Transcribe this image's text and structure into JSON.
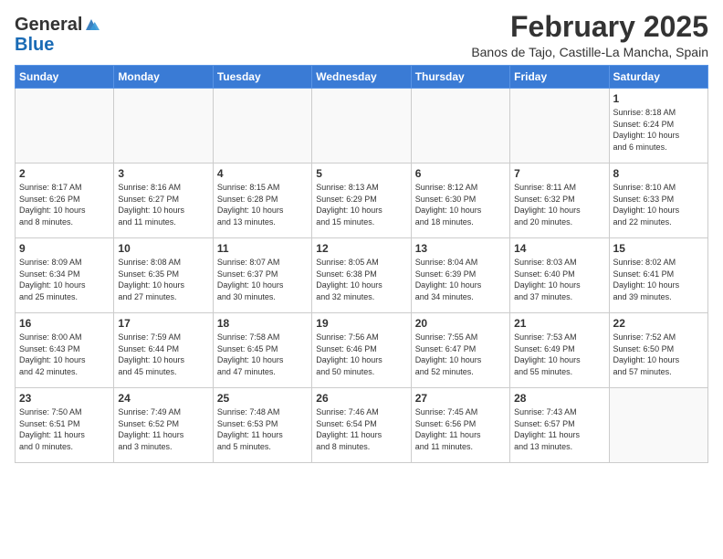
{
  "logo": {
    "general": "General",
    "blue": "Blue"
  },
  "title": {
    "month": "February 2025",
    "location": "Banos de Tajo, Castille-La Mancha, Spain"
  },
  "weekdays": [
    "Sunday",
    "Monday",
    "Tuesday",
    "Wednesday",
    "Thursday",
    "Friday",
    "Saturday"
  ],
  "weeks": [
    [
      {
        "day": "",
        "info": ""
      },
      {
        "day": "",
        "info": ""
      },
      {
        "day": "",
        "info": ""
      },
      {
        "day": "",
        "info": ""
      },
      {
        "day": "",
        "info": ""
      },
      {
        "day": "",
        "info": ""
      },
      {
        "day": "1",
        "info": "Sunrise: 8:18 AM\nSunset: 6:24 PM\nDaylight: 10 hours\nand 6 minutes."
      }
    ],
    [
      {
        "day": "2",
        "info": "Sunrise: 8:17 AM\nSunset: 6:26 PM\nDaylight: 10 hours\nand 8 minutes."
      },
      {
        "day": "3",
        "info": "Sunrise: 8:16 AM\nSunset: 6:27 PM\nDaylight: 10 hours\nand 11 minutes."
      },
      {
        "day": "4",
        "info": "Sunrise: 8:15 AM\nSunset: 6:28 PM\nDaylight: 10 hours\nand 13 minutes."
      },
      {
        "day": "5",
        "info": "Sunrise: 8:13 AM\nSunset: 6:29 PM\nDaylight: 10 hours\nand 15 minutes."
      },
      {
        "day": "6",
        "info": "Sunrise: 8:12 AM\nSunset: 6:30 PM\nDaylight: 10 hours\nand 18 minutes."
      },
      {
        "day": "7",
        "info": "Sunrise: 8:11 AM\nSunset: 6:32 PM\nDaylight: 10 hours\nand 20 minutes."
      },
      {
        "day": "8",
        "info": "Sunrise: 8:10 AM\nSunset: 6:33 PM\nDaylight: 10 hours\nand 22 minutes."
      }
    ],
    [
      {
        "day": "9",
        "info": "Sunrise: 8:09 AM\nSunset: 6:34 PM\nDaylight: 10 hours\nand 25 minutes."
      },
      {
        "day": "10",
        "info": "Sunrise: 8:08 AM\nSunset: 6:35 PM\nDaylight: 10 hours\nand 27 minutes."
      },
      {
        "day": "11",
        "info": "Sunrise: 8:07 AM\nSunset: 6:37 PM\nDaylight: 10 hours\nand 30 minutes."
      },
      {
        "day": "12",
        "info": "Sunrise: 8:05 AM\nSunset: 6:38 PM\nDaylight: 10 hours\nand 32 minutes."
      },
      {
        "day": "13",
        "info": "Sunrise: 8:04 AM\nSunset: 6:39 PM\nDaylight: 10 hours\nand 34 minutes."
      },
      {
        "day": "14",
        "info": "Sunrise: 8:03 AM\nSunset: 6:40 PM\nDaylight: 10 hours\nand 37 minutes."
      },
      {
        "day": "15",
        "info": "Sunrise: 8:02 AM\nSunset: 6:41 PM\nDaylight: 10 hours\nand 39 minutes."
      }
    ],
    [
      {
        "day": "16",
        "info": "Sunrise: 8:00 AM\nSunset: 6:43 PM\nDaylight: 10 hours\nand 42 minutes."
      },
      {
        "day": "17",
        "info": "Sunrise: 7:59 AM\nSunset: 6:44 PM\nDaylight: 10 hours\nand 45 minutes."
      },
      {
        "day": "18",
        "info": "Sunrise: 7:58 AM\nSunset: 6:45 PM\nDaylight: 10 hours\nand 47 minutes."
      },
      {
        "day": "19",
        "info": "Sunrise: 7:56 AM\nSunset: 6:46 PM\nDaylight: 10 hours\nand 50 minutes."
      },
      {
        "day": "20",
        "info": "Sunrise: 7:55 AM\nSunset: 6:47 PM\nDaylight: 10 hours\nand 52 minutes."
      },
      {
        "day": "21",
        "info": "Sunrise: 7:53 AM\nSunset: 6:49 PM\nDaylight: 10 hours\nand 55 minutes."
      },
      {
        "day": "22",
        "info": "Sunrise: 7:52 AM\nSunset: 6:50 PM\nDaylight: 10 hours\nand 57 minutes."
      }
    ],
    [
      {
        "day": "23",
        "info": "Sunrise: 7:50 AM\nSunset: 6:51 PM\nDaylight: 11 hours\nand 0 minutes."
      },
      {
        "day": "24",
        "info": "Sunrise: 7:49 AM\nSunset: 6:52 PM\nDaylight: 11 hours\nand 3 minutes."
      },
      {
        "day": "25",
        "info": "Sunrise: 7:48 AM\nSunset: 6:53 PM\nDaylight: 11 hours\nand 5 minutes."
      },
      {
        "day": "26",
        "info": "Sunrise: 7:46 AM\nSunset: 6:54 PM\nDaylight: 11 hours\nand 8 minutes."
      },
      {
        "day": "27",
        "info": "Sunrise: 7:45 AM\nSunset: 6:56 PM\nDaylight: 11 hours\nand 11 minutes."
      },
      {
        "day": "28",
        "info": "Sunrise: 7:43 AM\nSunset: 6:57 PM\nDaylight: 11 hours\nand 13 minutes."
      },
      {
        "day": "",
        "info": ""
      }
    ]
  ]
}
